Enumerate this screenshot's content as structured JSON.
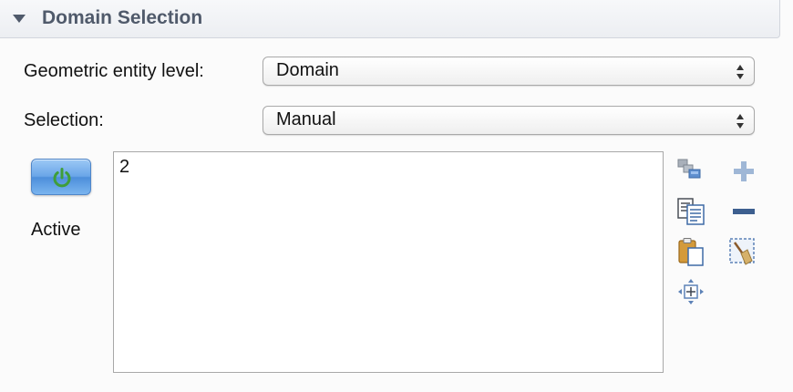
{
  "section": {
    "title": "Domain Selection"
  },
  "geometric_entity_level": {
    "label": "Geometric entity level:",
    "selected": "Domain"
  },
  "selection": {
    "label": "Selection:",
    "selected": "Manual"
  },
  "active_toggle": {
    "label": "Active",
    "state": "on",
    "icon": "power-icon",
    "icon_color": "#3f9e3a"
  },
  "selection_list": {
    "items": [
      "2"
    ]
  },
  "toolbar": {
    "icons": [
      "copy-selection-icon",
      "paste-selection-icon",
      "zoom-to-selection-icon",
      "add-to-selection-icon",
      "remove-from-selection-icon",
      "clear-selection-icon"
    ]
  },
  "colors": {
    "header_text": "#505a6b",
    "button_blue": "#5b9ae0",
    "icon_blue": "#5d82b7"
  }
}
